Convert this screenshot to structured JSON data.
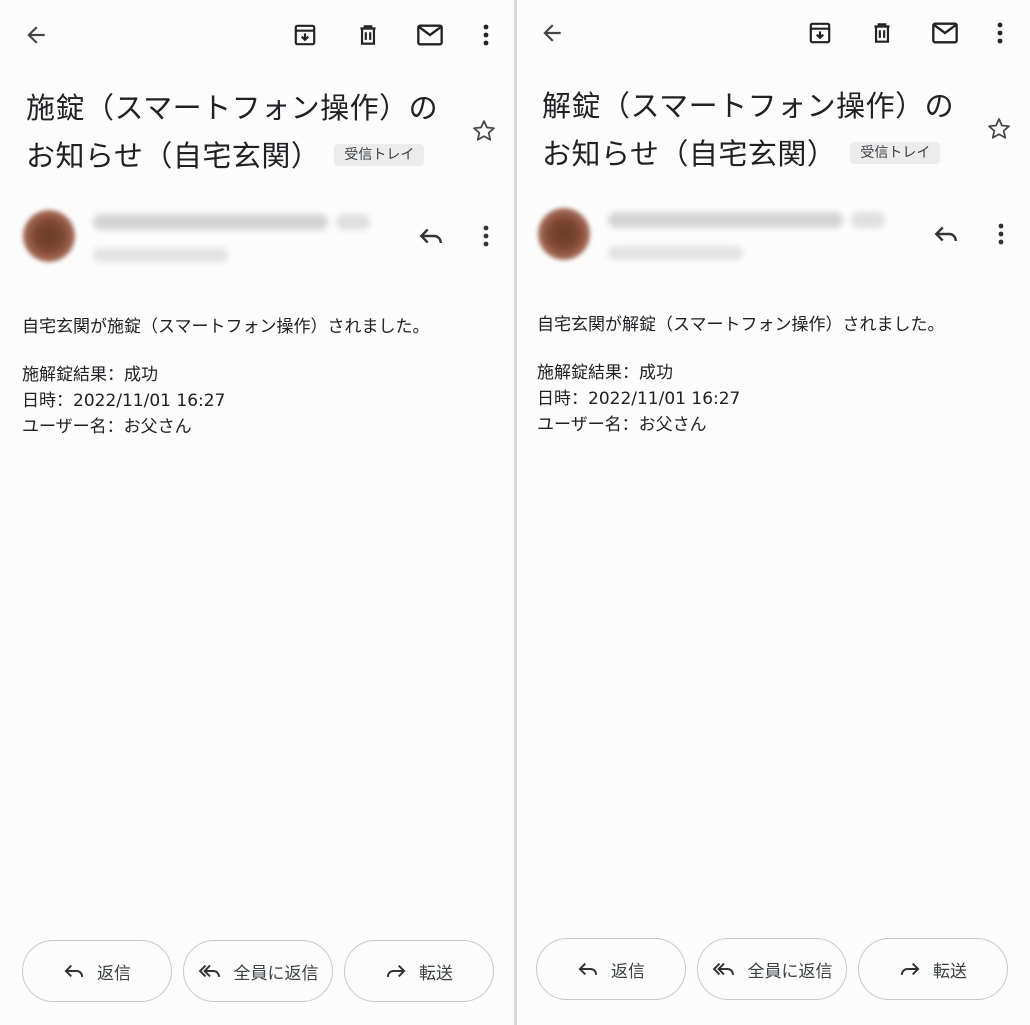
{
  "panels": [
    {
      "subject": "施錠（スマートフォン操作）のお知らせ（自宅玄関）",
      "label": "受信トレイ",
      "body_line1": "自宅玄関が施錠（スマートフォン操作）されました。",
      "result": "施解錠結果：成功",
      "datetime": "日時：2022/11/01 16:27",
      "user": "ユーザー名：お父さん"
    },
    {
      "subject": "解錠（スマートフォン操作）のお知らせ（自宅玄関）",
      "label": "受信トレイ",
      "body_line1": "自宅玄関が解錠（スマートフォン操作）されました。",
      "result": "施解錠結果：成功",
      "datetime": "日時：2022/11/01 16:27",
      "user": "ユーザー名：お父さん"
    }
  ],
  "actions": {
    "reply": "返信",
    "reply_all": "全員に返信",
    "forward": "転送"
  },
  "icons": [
    "back-arrow-icon",
    "archive-icon",
    "trash-icon",
    "mail-icon",
    "more-vert-icon",
    "star-icon",
    "reply-icon",
    "reply-all-icon",
    "forward-icon"
  ]
}
